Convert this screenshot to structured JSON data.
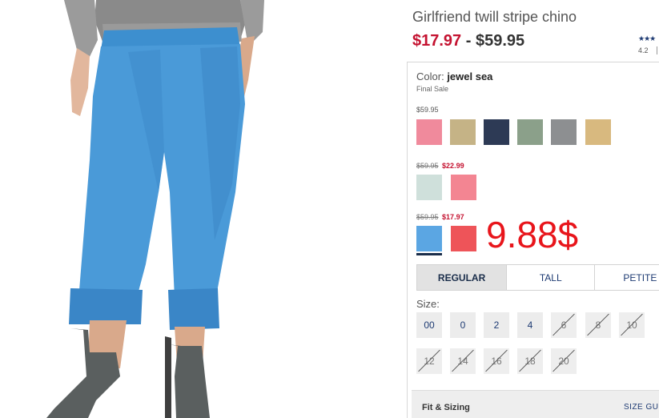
{
  "product": {
    "title": "Girlfriend twill stripe chino",
    "price_sale": "$17.97",
    "price_sep": "-",
    "price_regular": "$59.95",
    "rating_stars": "★★★",
    "rating_value": "4.2"
  },
  "color": {
    "label": "Color:",
    "selected_name": "jewel sea",
    "note": "Final Sale"
  },
  "swatch_groups": [
    {
      "price": "$59.95",
      "swatches": [
        {
          "name": "pink",
          "color": "#f08a9c"
        },
        {
          "name": "khaki",
          "color": "#c5b386"
        },
        {
          "name": "navy",
          "color": "#2d3a55"
        },
        {
          "name": "sage",
          "color": "#8ba08a"
        },
        {
          "name": "grey",
          "color": "#8d8f91"
        },
        {
          "name": "sand",
          "color": "#d8b97f"
        }
      ]
    },
    {
      "original_price": "$59.95",
      "sale_price": "$22.99",
      "swatches": [
        {
          "name": "mint",
          "color": "#cfe0db"
        },
        {
          "name": "coral-pink",
          "color": "#f38592"
        }
      ]
    },
    {
      "original_price": "$59.95",
      "sale_price": "$17.97",
      "swatches": [
        {
          "name": "jewel-sea",
          "color": "#5ba6e3",
          "selected": true
        },
        {
          "name": "red-coral",
          "color": "#ee5459"
        }
      ]
    }
  ],
  "overlay_price": "9.88$",
  "fit_tabs": [
    "REGULAR",
    "TALL",
    "PETITE"
  ],
  "size": {
    "label": "Size:",
    "options": [
      {
        "label": "00",
        "available": true
      },
      {
        "label": "0",
        "available": true
      },
      {
        "label": "2",
        "available": true
      },
      {
        "label": "4",
        "available": true
      },
      {
        "label": "6",
        "available": false
      },
      {
        "label": "8",
        "available": false
      },
      {
        "label": "10",
        "available": false
      },
      {
        "label": "12",
        "available": false
      },
      {
        "label": "14",
        "available": false
      },
      {
        "label": "16",
        "available": false
      },
      {
        "label": "18",
        "available": false
      },
      {
        "label": "20",
        "available": false
      }
    ]
  },
  "fit_sizing": {
    "title": "Fit & Sizing",
    "guide": "SIZE GU"
  }
}
